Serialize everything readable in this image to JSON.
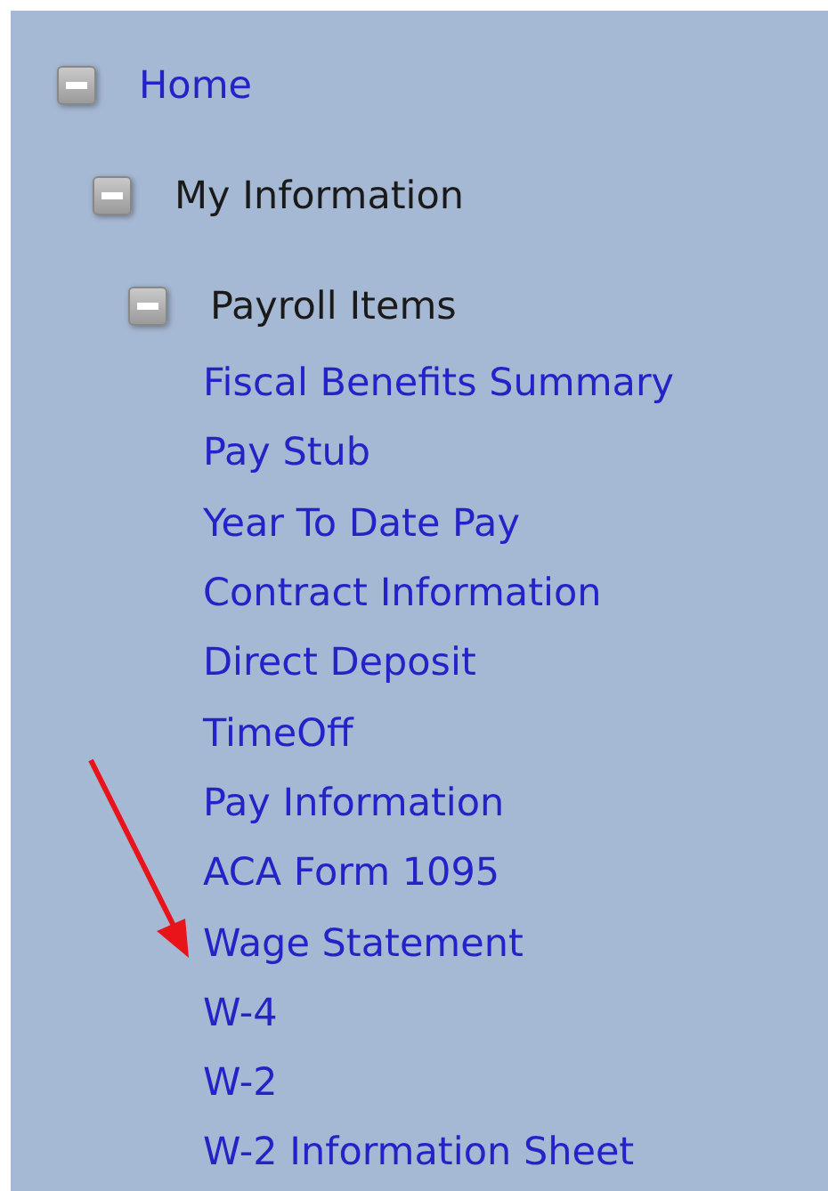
{
  "tree": [
    {
      "label": "Home",
      "kind": "link",
      "expanded": true,
      "children": [
        {
          "label": "My Information",
          "kind": "label",
          "expanded": true,
          "children": [
            {
              "label": "Payroll Items",
              "kind": "label",
              "expanded": true,
              "children": [
                {
                  "label": "Fiscal Benefits Summary",
                  "kind": "link"
                },
                {
                  "label": "Pay Stub",
                  "kind": "link"
                },
                {
                  "label": "Year To Date Pay",
                  "kind": "link"
                },
                {
                  "label": "Contract Information",
                  "kind": "link"
                },
                {
                  "label": "Direct Deposit",
                  "kind": "link"
                },
                {
                  "label": "TimeOff",
                  "kind": "link"
                },
                {
                  "label": "Pay Information",
                  "kind": "link"
                },
                {
                  "label": "ACA Form 1095",
                  "kind": "link"
                },
                {
                  "label": "Wage Statement",
                  "kind": "link"
                },
                {
                  "label": "W-4",
                  "kind": "link"
                },
                {
                  "label": "W-2",
                  "kind": "link"
                },
                {
                  "label": "W-2 Information Sheet",
                  "kind": "link"
                }
              ]
            }
          ]
        }
      ]
    }
  ]
}
